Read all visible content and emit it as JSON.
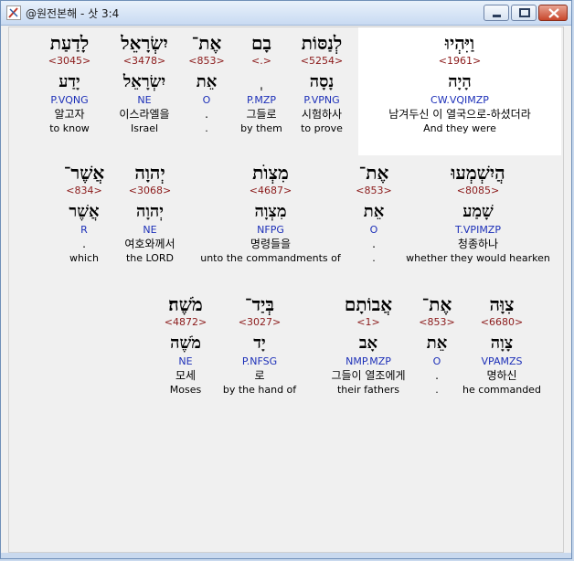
{
  "window": {
    "title": "@원전본해 - 삿 3:4"
  },
  "rows": [
    [
      {
        "heb": "וַיִּהְיוּ",
        "num": "<1961>",
        "lemma": "הָיָה",
        "morph": "CW.VQIMZP",
        "kor": "남겨두신 이 열국으로-하셨더라",
        "eng": "And they were"
      },
      {
        "heb": "לְנַסּוֹת",
        "num": "<5254>",
        "lemma": "נָסָה",
        "morph": "P.VPNG",
        "kor": "시험하사",
        "eng": "to prove"
      },
      {
        "heb": "בָם",
        "num": "<.>",
        "lemma": "ְ",
        "morph": "P.MZP",
        "kor": "그들로",
        "eng": "by them"
      },
      {
        "heb": "אֶת־",
        "num": "<853>",
        "lemma": "אֵת",
        "morph": "O",
        "kor": ".",
        "eng": "."
      },
      {
        "heb": "יִשְׂרָאֵל",
        "num": "<3478>",
        "lemma": "יִשְׂרָאֵל",
        "morph": "NE",
        "kor": "이스라엘을",
        "eng": "Israel"
      },
      {
        "heb": "לָדַעַת",
        "num": "<3045>",
        "lemma": "יָדַע",
        "morph": "P.VQNG",
        "kor": "알고자",
        "eng": "to know"
      }
    ],
    [
      {
        "heb": "הֲיִשְׁמְעוּ",
        "num": "<8085>",
        "lemma": "שָׁמַע",
        "morph": "T.VPIMZP",
        "kor": "청종하나",
        "eng": "whether they would hearken"
      },
      {
        "heb": "אֶת־",
        "num": "<853>",
        "lemma": "אֵת",
        "morph": "O",
        "kor": ".",
        "eng": "."
      },
      {
        "heb": "מִצְוֺת",
        "num": "<4687>",
        "lemma": "מִצְוָה",
        "morph": "NFPG",
        "kor": "명령들을",
        "eng": "unto the commandments of"
      },
      {
        "heb": "יְהוָה",
        "num": "<3068>",
        "lemma": "יְהוָה",
        "morph": "NE",
        "kor": "여호와께서",
        "eng": "the LORD"
      },
      {
        "heb": "אֲשֶׁר־",
        "num": "<834>",
        "lemma": "אֲשֶׁר",
        "morph": "R",
        "kor": ".",
        "eng": "which"
      }
    ],
    [
      {
        "heb": "צִוָּה",
        "num": "<6680>",
        "lemma": "צָוָה",
        "morph": "VPAMZS",
        "kor": "명하신",
        "eng": "he commanded"
      },
      {
        "heb": "אֶת־",
        "num": "<853>",
        "lemma": "אֵת",
        "morph": "O",
        "kor": ".",
        "eng": "."
      },
      {
        "heb": "אֲבוֹתָם",
        "num": "<1>",
        "lemma": "אָב",
        "morph": "NMP.MZP",
        "kor": "그들이 열조에게",
        "eng": "their fathers"
      },
      {
        "heb": "בְּיַד־",
        "num": "<3027>",
        "lemma": "יָד",
        "morph": "P.NFSG",
        "kor": "로",
        "eng": "by the hand of"
      },
      {
        "heb": "מֹשֶׁה׃",
        "num": "<4872>",
        "lemma": "מֹשֶׁה",
        "morph": "NE",
        "kor": "모세",
        "eng": "Moses"
      }
    ]
  ]
}
